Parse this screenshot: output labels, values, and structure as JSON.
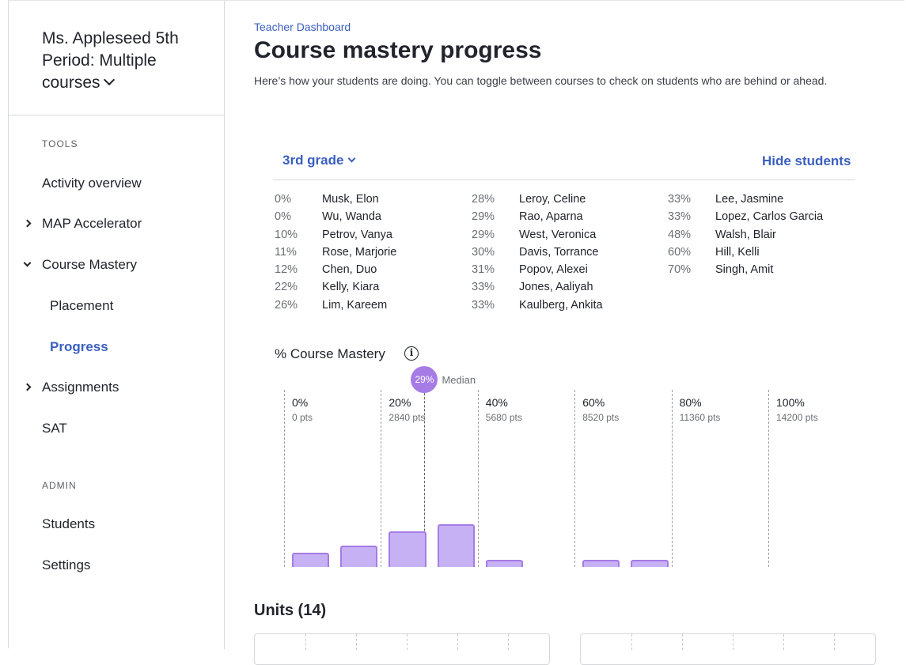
{
  "sidebar": {
    "class_title": "Ms. Appleseed 5th Period: Multiple courses",
    "tools_label": "TOOLS",
    "admin_label": "ADMIN",
    "items": [
      {
        "label": "Activity overview"
      },
      {
        "label": "MAP Accelerator"
      },
      {
        "label": "Course Mastery"
      },
      {
        "label": "Placement"
      },
      {
        "label": "Progress"
      },
      {
        "label": "Assignments"
      },
      {
        "label": "SAT"
      },
      {
        "label": "Students"
      },
      {
        "label": "Settings"
      }
    ]
  },
  "header": {
    "breadcrumb": "Teacher Dashboard",
    "title": "Course mastery progress",
    "description": "Here’s how your students are doing. You can toggle between courses to check on students who are behind or ahead."
  },
  "controls": {
    "grade": "3rd grade",
    "hide_students": "Hide students"
  },
  "students": [
    [
      {
        "pct": "0%",
        "name": "Musk, Elon"
      },
      {
        "pct": "0%",
        "name": "Wu, Wanda"
      },
      {
        "pct": "10%",
        "name": "Petrov, Vanya"
      },
      {
        "pct": "11%",
        "name": "Rose, Marjorie"
      },
      {
        "pct": "12%",
        "name": "Chen, Duo"
      },
      {
        "pct": "22%",
        "name": "Kelly, Kiara"
      },
      {
        "pct": "26%",
        "name": "Lim, Kareem"
      }
    ],
    [
      {
        "pct": "28%",
        "name": "Leroy, Celine"
      },
      {
        "pct": "29%",
        "name": "Rao, Aparna"
      },
      {
        "pct": "29%",
        "name": "West, Veronica"
      },
      {
        "pct": "30%",
        "name": "Davis, Torrance"
      },
      {
        "pct": "31%",
        "name": "Popov, Alexei"
      },
      {
        "pct": "33%",
        "name": "Jones, Aaliyah"
      },
      {
        "pct": "33%",
        "name": "Kaulberg, Ankita"
      }
    ],
    [
      {
        "pct": "33%",
        "name": "Lee, Jasmine"
      },
      {
        "pct": "33%",
        "name": "Lopez, Carlos Garcia"
      },
      {
        "pct": "48%",
        "name": "Walsh, Blair"
      },
      {
        "pct": "60%",
        "name": "Hill, Kelli"
      },
      {
        "pct": "70%",
        "name": "Singh, Amit"
      }
    ]
  ],
  "chart_data": {
    "type": "bar",
    "title": "% Course Mastery",
    "median": {
      "value": 29,
      "badge": "29%",
      "label": "Median"
    },
    "ticks": [
      {
        "pct": "0%",
        "pts": "0 pts",
        "value": 0
      },
      {
        "pct": "20%",
        "pts": "2840 pts",
        "value": 20
      },
      {
        "pct": "40%",
        "pts": "5680 pts",
        "value": 40
      },
      {
        "pct": "60%",
        "pts": "8520 pts",
        "value": 60
      },
      {
        "pct": "80%",
        "pts": "11360 pts",
        "value": 80
      },
      {
        "pct": "100%",
        "pts": "14200 pts",
        "value": 100
      }
    ],
    "bins": [
      {
        "x0": 0,
        "x1": 10,
        "count": 2
      },
      {
        "x0": 10,
        "x1": 20,
        "count": 3
      },
      {
        "x0": 20,
        "x1": 30,
        "count": 5
      },
      {
        "x0": 30,
        "x1": 40,
        "count": 6
      },
      {
        "x0": 40,
        "x1": 50,
        "count": 1
      },
      {
        "x0": 50,
        "x1": 60,
        "count": 0
      },
      {
        "x0": 60,
        "x1": 70,
        "count": 1
      },
      {
        "x0": 70,
        "x1": 80,
        "count": 1
      }
    ],
    "ylim": [
      0,
      8
    ],
    "bar_color": "#c7b1f5",
    "bar_border": "#a67be6"
  },
  "units": {
    "title": "Units (14)"
  }
}
